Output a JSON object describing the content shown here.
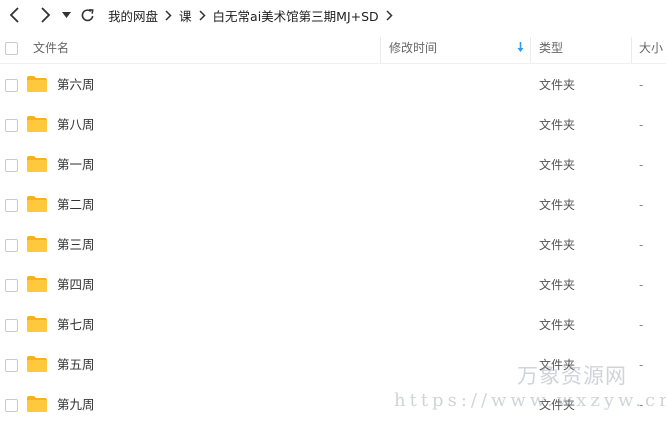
{
  "breadcrumb": [
    "我的网盘",
    "课",
    "白无常ai美术馆第三期MJ+SD"
  ],
  "header": {
    "name": "文件名",
    "modified": "修改时间",
    "type": "类型",
    "size": "大小"
  },
  "files": [
    {
      "name": "第六周",
      "type": "文件夹",
      "size": "-"
    },
    {
      "name": "第八周",
      "type": "文件夹",
      "size": "-"
    },
    {
      "name": "第一周",
      "type": "文件夹",
      "size": "-"
    },
    {
      "name": "第二周",
      "type": "文件夹",
      "size": "-"
    },
    {
      "name": "第三周",
      "type": "文件夹",
      "size": "-"
    },
    {
      "name": "第四周",
      "type": "文件夹",
      "size": "-"
    },
    {
      "name": "第七周",
      "type": "文件夹",
      "size": "-"
    },
    {
      "name": "第五周",
      "type": "文件夹",
      "size": "-"
    },
    {
      "name": "第九周",
      "type": "文件夹",
      "size": "-"
    }
  ],
  "sort": {
    "column": "modified",
    "direction": "descending"
  },
  "watermark": {
    "line1": "万象资源网",
    "line2": "https://www.wxzyw.cn"
  },
  "colors": {
    "folder": "#ffc83d",
    "folder_back": "#f6b21a",
    "sort_arrow": "#2b9bf4"
  },
  "icons": [
    "back-icon",
    "forward-icon",
    "dropdown-icon",
    "refresh-icon",
    "chevron-right-icon",
    "sort-down-arrow-icon",
    "folder-icon"
  ]
}
